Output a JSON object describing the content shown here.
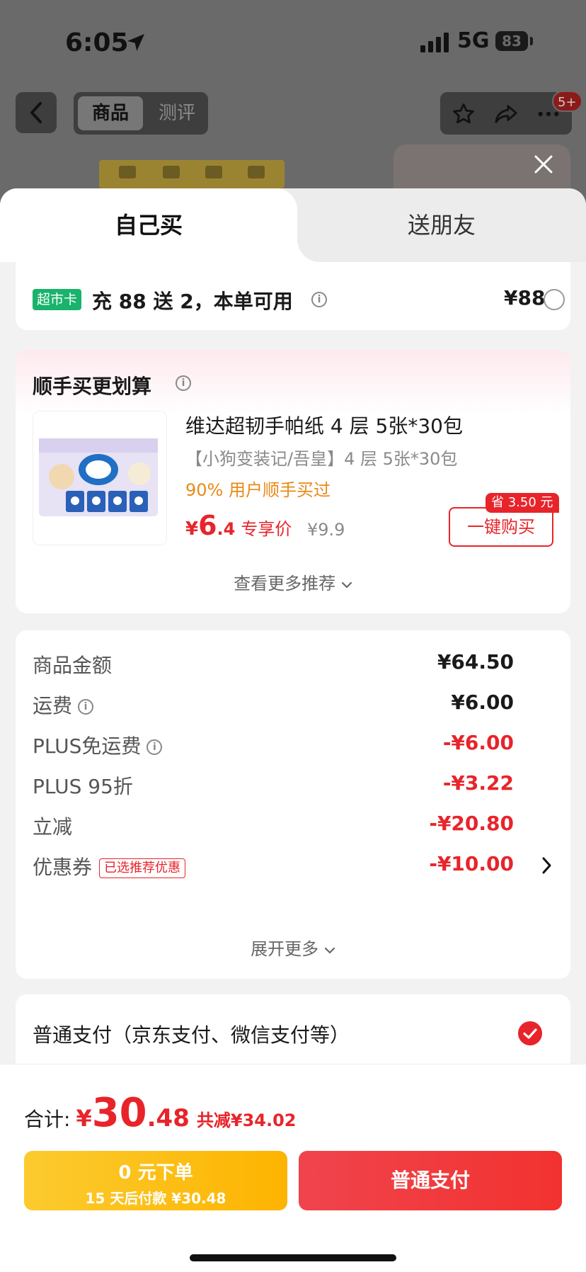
{
  "status_bar": {
    "time": "6:05",
    "network": "5G",
    "battery": "83"
  },
  "background_nav": {
    "tabs": [
      "商品",
      "测评"
    ],
    "notification_badge": "5+"
  },
  "sheet_tabs": {
    "self": "自己买",
    "friend": "送朋友"
  },
  "supermarket_card": {
    "tag": "超市卡",
    "text": "充 88 送 2，本单可用",
    "price": "¥88"
  },
  "addon": {
    "title": "顺手买更划算",
    "name": "维达超韧手帕纸 4 层 5张*30包",
    "subtitle": "【小狗变装记/吾皇】4 层 5张*30包",
    "popularity": "90% 用户顺手买过",
    "price_currency": "¥",
    "price_int": "6",
    "price_dec": ".4",
    "price_label": "专享价",
    "original_price": "¥9.9",
    "save_badge": "省 3.50 元",
    "buy_button": "一键购买",
    "more": "查看更多推荐"
  },
  "summary": {
    "rows": [
      {
        "key": "商品金额",
        "value": "¥64.50",
        "red": false
      },
      {
        "key": "运费",
        "value": "¥6.00",
        "red": false
      },
      {
        "key": "PLUS免运费",
        "value": "-¥6.00",
        "red": true
      },
      {
        "key": "PLUS 95折",
        "value": "-¥3.22",
        "red": true
      },
      {
        "key": "立减",
        "value": "-¥20.80",
        "red": true
      },
      {
        "key": "优惠券",
        "value": "-¥10.00",
        "red": true
      }
    ],
    "coupon_tag": "已选推荐优惠",
    "more": "展开更多"
  },
  "payment": {
    "method": "普通支付（京东支付、微信支付等）"
  },
  "bottom": {
    "total_label": "合计:",
    "total_currency": "¥",
    "total_int": "30",
    "total_dec": ".48",
    "total_reduce": "共减¥34.02",
    "zero_btn_line1": "0 元下单",
    "zero_btn_line2": "15 天后付款 ¥30.48",
    "pay_btn": "普通支付"
  },
  "colors": {
    "accent_red": "#e8242b",
    "yellow": "#fdb400",
    "green_tag": "#19b36b"
  },
  "icons": [
    "location-arrow-icon",
    "signal-icon",
    "back-chevron-icon",
    "star-icon",
    "share-icon",
    "more-dots-icon",
    "close-icon",
    "info-icon",
    "chevron-down-icon",
    "chevron-right-icon",
    "check-icon"
  ]
}
